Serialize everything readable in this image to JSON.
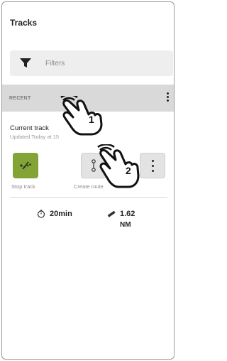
{
  "header": {
    "title": "Tracks"
  },
  "filters": {
    "label": "Filters",
    "icon": "filter-icon"
  },
  "section": {
    "label": "RECENT",
    "menu_icon": "kebab-icon"
  },
  "track": {
    "name": "Current track",
    "subtitle": "Updated Today at 15",
    "actions": [
      {
        "label": "Stop track",
        "icon": "stop-track-icon",
        "color": "#82a335"
      },
      {
        "label": "Create route",
        "icon": "route-icon"
      },
      {
        "label": "",
        "icon": "more-icon"
      }
    ],
    "stats": {
      "duration": "20min",
      "distance_value": "1.62",
      "distance_unit": "NM"
    }
  },
  "callouts": [
    {
      "number": "1",
      "icon": "tap-hand-icon"
    },
    {
      "number": "2",
      "icon": "tap-hand-icon"
    }
  ]
}
